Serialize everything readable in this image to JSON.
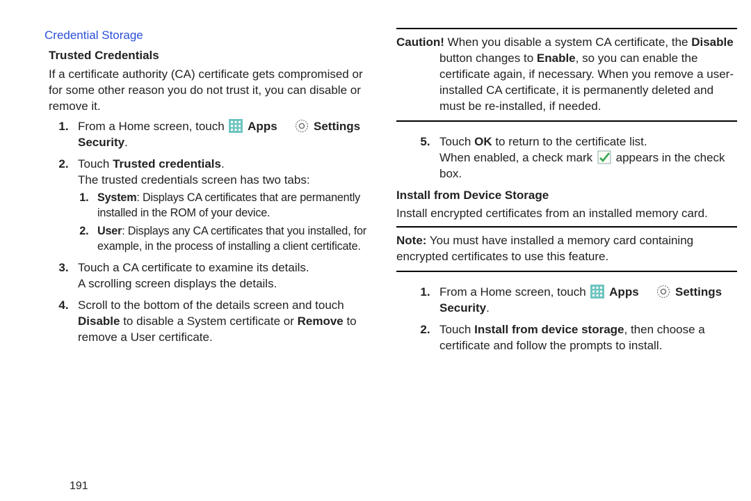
{
  "left": {
    "section_title": "Credential Storage",
    "subhead": "Trusted Credentials",
    "intro": "If a certificate authority (CA) certificate gets compromised or for some other reason you do not trust it, you can disable or remove it.",
    "step1_prefix": "From a Home screen, touch ",
    "step1_apps": "Apps",
    "step1_settings": "Settings",
    "step1_security": "Security",
    "step2_text_a": "Touch ",
    "step2_bold": "Trusted credentials",
    "step2_text_b": ".",
    "step2_cont": "The trusted credentials screen has two tabs:",
    "bul_system_label": "System",
    "bul_system_text": ": Displays CA certificates that are permanently installed in the ROM of your device.",
    "bul_user_label": "User",
    "bul_user_text": ": Displays any CA certificates that you installed, for example, in the process of installing a client certificate.",
    "step3_line1": "Touch a CA certificate to examine its details.",
    "step3_line2": "A scrolling screen displays the details.",
    "step4_a": "Scroll to the bottom of the details screen and touch ",
    "step4_disable": "Disable",
    "step4_b": " to disable a System certificate or ",
    "step4_remove": "Remove",
    "step4_c": " to remove a User certificate."
  },
  "right": {
    "caution_label": "Caution!",
    "caution_a": " When you disable a system CA certificate, the ",
    "caution_disable": "Disable",
    "caution_b": " button changes to ",
    "caution_enable": "Enable",
    "caution_c": ", so you can enable the certificate again, if necessary. When you remove a user-installed CA certificate, it is permanently deleted and must be re-installed, if needed.",
    "step5_a": "Touch ",
    "step5_ok": "OK",
    "step5_b": " to return to the certificate list.",
    "step5_c_a": "When enabled, a check mark ",
    "step5_c_b": " appears in the check box.",
    "install_head": "Install from Device Storage",
    "install_body": "Install encrypted certificates from an installed memory card.",
    "note_label": "Note:",
    "note_a": " You must have installed a memory card containing encrypted certificates to use this feature.",
    "istep1_prefix": "From a Home screen, touch ",
    "istep1_apps": "Apps",
    "istep1_settings": "Settings",
    "istep1_security": "Security",
    "istep2_a": "Touch ",
    "istep2_bold": "Install from device storage",
    "istep2_b": ", then choose a certificate and follow the prompts to install."
  },
  "page_number": "191"
}
